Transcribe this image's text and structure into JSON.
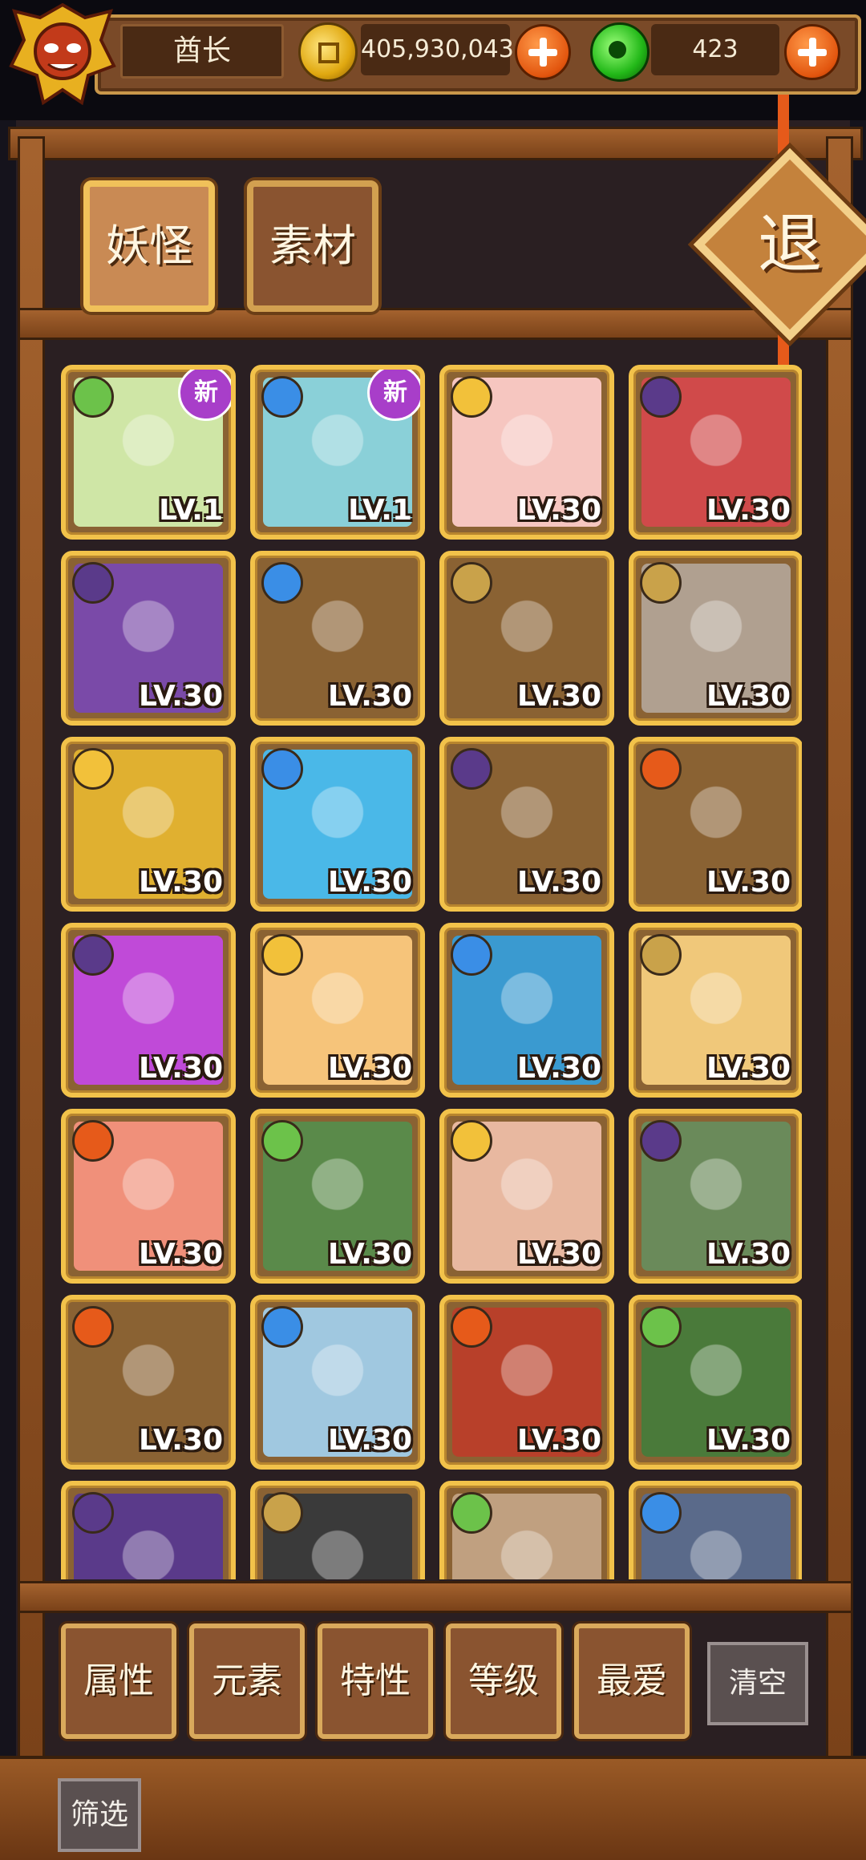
{
  "player": {
    "name": "酋长"
  },
  "currency": {
    "gold": "405,930,043",
    "gems": "423"
  },
  "tabs": [
    {
      "label": "妖怪",
      "active": true
    },
    {
      "label": "素材",
      "active": false
    }
  ],
  "exit_label": "退",
  "new_badge_label": "新",
  "element_colors": {
    "grass": "#6cc24a",
    "water": "#3a8ee6",
    "light": "#f2c13a",
    "dark": "#5a3a8a",
    "earth": "#c9a24a",
    "fire": "#e65a1a"
  },
  "cards": [
    {
      "level": "LV.1",
      "element": "grass",
      "is_new": true,
      "art": "#cfe6a6",
      "subject": "green-sprout-blob"
    },
    {
      "level": "LV.1",
      "element": "water",
      "is_new": true,
      "art": "#8ad0d8",
      "subject": "blue-flower-blob"
    },
    {
      "level": "LV.30",
      "element": "light",
      "is_new": false,
      "art": "#f6c6c0",
      "subject": "fox-mask-girl"
    },
    {
      "level": "LV.30",
      "element": "dark",
      "is_new": false,
      "art": "#d04a4a",
      "subject": "blue-hair-oni-girl"
    },
    {
      "level": "LV.30",
      "element": "dark",
      "is_new": false,
      "art": "#7a4aa8",
      "subject": "egyptian-queen"
    },
    {
      "level": "LV.30",
      "element": "water",
      "is_new": false,
      "art": "#8a6233",
      "subject": "white-chess-queen"
    },
    {
      "level": "LV.30",
      "element": "earth",
      "is_new": false,
      "art": "#8a6233",
      "subject": "black-chess-king"
    },
    {
      "level": "LV.30",
      "element": "earth",
      "is_new": false,
      "art": "#b0a090",
      "subject": "white-beast-mask"
    },
    {
      "level": "LV.30",
      "element": "light",
      "is_new": false,
      "art": "#e0b030",
      "subject": "golden-knight"
    },
    {
      "level": "LV.30",
      "element": "water",
      "is_new": false,
      "art": "#4ab8e8",
      "subject": "blue-hair-deer-girl"
    },
    {
      "level": "LV.30",
      "element": "dark",
      "is_new": false,
      "art": "#8a6233",
      "subject": "blue-tissue-box"
    },
    {
      "level": "LV.30",
      "element": "fire",
      "is_new": false,
      "art": "#8a6233",
      "subject": "ten-of-hearts-card"
    },
    {
      "level": "LV.30",
      "element": "dark",
      "is_new": false,
      "art": "#c04ad8",
      "subject": "white-hair-elf"
    },
    {
      "level": "LV.30",
      "element": "light",
      "is_new": false,
      "art": "#f6c47a",
      "subject": "golden-fox-spirit"
    },
    {
      "level": "LV.30",
      "element": "water",
      "is_new": false,
      "art": "#3a9ad0",
      "subject": "wave-princess"
    },
    {
      "level": "LV.30",
      "element": "earth",
      "is_new": false,
      "art": "#f0c87a",
      "subject": "flute-fairy"
    },
    {
      "level": "LV.30",
      "element": "fire",
      "is_new": false,
      "art": "#f0907a",
      "subject": "pink-lion-girl"
    },
    {
      "level": "LV.30",
      "element": "grass",
      "is_new": false,
      "art": "#5a8a4a",
      "subject": "cow-horn-maiden"
    },
    {
      "level": "LV.30",
      "element": "light",
      "is_new": false,
      "art": "#e8b8a0",
      "subject": "flower-crown-girl"
    },
    {
      "level": "LV.30",
      "element": "dark",
      "is_new": false,
      "art": "#6a8a5a",
      "subject": "purple-hair-scholar"
    },
    {
      "level": "LV.30",
      "element": "fire",
      "is_new": false,
      "art": "#8a6233",
      "subject": "white-dice"
    },
    {
      "level": "LV.30",
      "element": "water",
      "is_new": false,
      "art": "#a0c8e0",
      "subject": "old-sage"
    },
    {
      "level": "LV.30",
      "element": "fire",
      "is_new": false,
      "art": "#b8402a",
      "subject": "black-hair-fighter"
    },
    {
      "level": "LV.30",
      "element": "grass",
      "is_new": false,
      "art": "#4a7a3a",
      "subject": "green-hair-musician"
    },
    {
      "level": "",
      "element": "dark",
      "is_new": false,
      "art": "#5a3a8a",
      "subject": "skull-witch"
    },
    {
      "level": "",
      "element": "earth",
      "is_new": false,
      "art": "#3a3a3a",
      "subject": "robot-helmet"
    },
    {
      "level": "",
      "element": "grass",
      "is_new": false,
      "art": "#c0a080",
      "subject": "glasses-boy"
    },
    {
      "level": "",
      "element": "water",
      "is_new": false,
      "art": "#5a6a8a",
      "subject": "blue-oni"
    }
  ],
  "filters": [
    "属性",
    "元素",
    "特性",
    "等级",
    "最爱"
  ],
  "clear_label": "清空",
  "screen_label": "筛选"
}
